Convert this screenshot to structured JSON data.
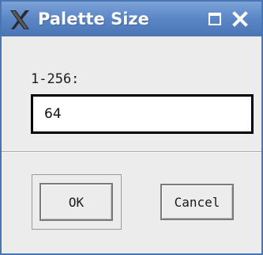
{
  "window": {
    "title": "Palette Size",
    "app_icon": "x-logo-icon",
    "controls": {
      "maximize_icon": "maximize-icon",
      "close_icon": "close-icon"
    }
  },
  "form": {
    "label": "1-256:",
    "value": "64"
  },
  "buttons": {
    "ok_label": "OK",
    "cancel_label": "Cancel"
  },
  "colors": {
    "titlebar": "#5a86c6",
    "background": "#ececec"
  }
}
